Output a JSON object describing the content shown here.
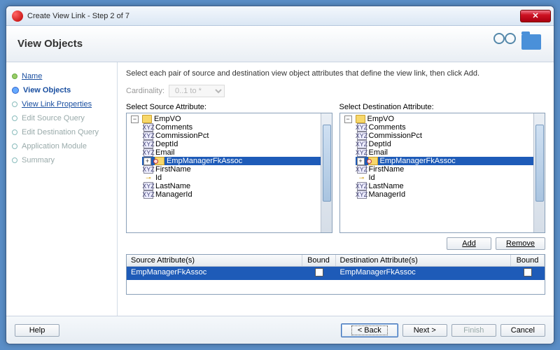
{
  "window": {
    "title": "Create View Link - Step 2 of 7"
  },
  "header": {
    "title": "View Objects"
  },
  "steps": [
    {
      "label": "Name",
      "state": "done"
    },
    {
      "label": "View Objects",
      "state": "current"
    },
    {
      "label": "View Link Properties",
      "state": "upcoming-link"
    },
    {
      "label": "Edit Source Query",
      "state": "disabled"
    },
    {
      "label": "Edit Destination Query",
      "state": "disabled"
    },
    {
      "label": "Application Module",
      "state": "disabled"
    },
    {
      "label": "Summary",
      "state": "disabled"
    }
  ],
  "instruction": "Select each pair of source and destination view object attributes that define the view link, then click Add.",
  "cardinality": {
    "label": "Cardinality:",
    "value": "0..1 to *"
  },
  "source": {
    "label": "Select Source Attribute:",
    "root": "EmpVO",
    "items": [
      {
        "name": "Comments",
        "kind": "xyz"
      },
      {
        "name": "CommissionPct",
        "kind": "xyz"
      },
      {
        "name": "DeptId",
        "kind": "xyz"
      },
      {
        "name": "Email",
        "kind": "xyz"
      },
      {
        "name": "EmpManagerFkAssoc",
        "kind": "assoc",
        "selected": true
      },
      {
        "name": "FirstName",
        "kind": "xyz"
      },
      {
        "name": "Id",
        "kind": "key"
      },
      {
        "name": "LastName",
        "kind": "xyz"
      },
      {
        "name": "ManagerId",
        "kind": "xyz"
      }
    ]
  },
  "dest": {
    "label": "Select Destination Attribute:",
    "root": "EmpVO",
    "items": [
      {
        "name": "Comments",
        "kind": "xyz"
      },
      {
        "name": "CommissionPct",
        "kind": "xyz"
      },
      {
        "name": "DeptId",
        "kind": "xyz"
      },
      {
        "name": "Email",
        "kind": "xyz"
      },
      {
        "name": "EmpManagerFkAssoc",
        "kind": "assoc",
        "selected": true
      },
      {
        "name": "FirstName",
        "kind": "xyz"
      },
      {
        "name": "Id",
        "kind": "key"
      },
      {
        "name": "LastName",
        "kind": "xyz"
      },
      {
        "name": "ManagerId",
        "kind": "xyz"
      }
    ]
  },
  "actions": {
    "add": "Add",
    "remove": "Remove"
  },
  "attrTable": {
    "headers": {
      "sa": "Source Attribute(s)",
      "b1": "Bound",
      "da": "Destination Attribute(s)",
      "b2": "Bound"
    },
    "rows": [
      {
        "sa": "EmpManagerFkAssoc",
        "b1": false,
        "da": "EmpManagerFkAssoc",
        "b2": false
      }
    ]
  },
  "footer": {
    "help": "Help",
    "back": "< Back",
    "next": "Next >",
    "finish": "Finish",
    "cancel": "Cancel"
  }
}
